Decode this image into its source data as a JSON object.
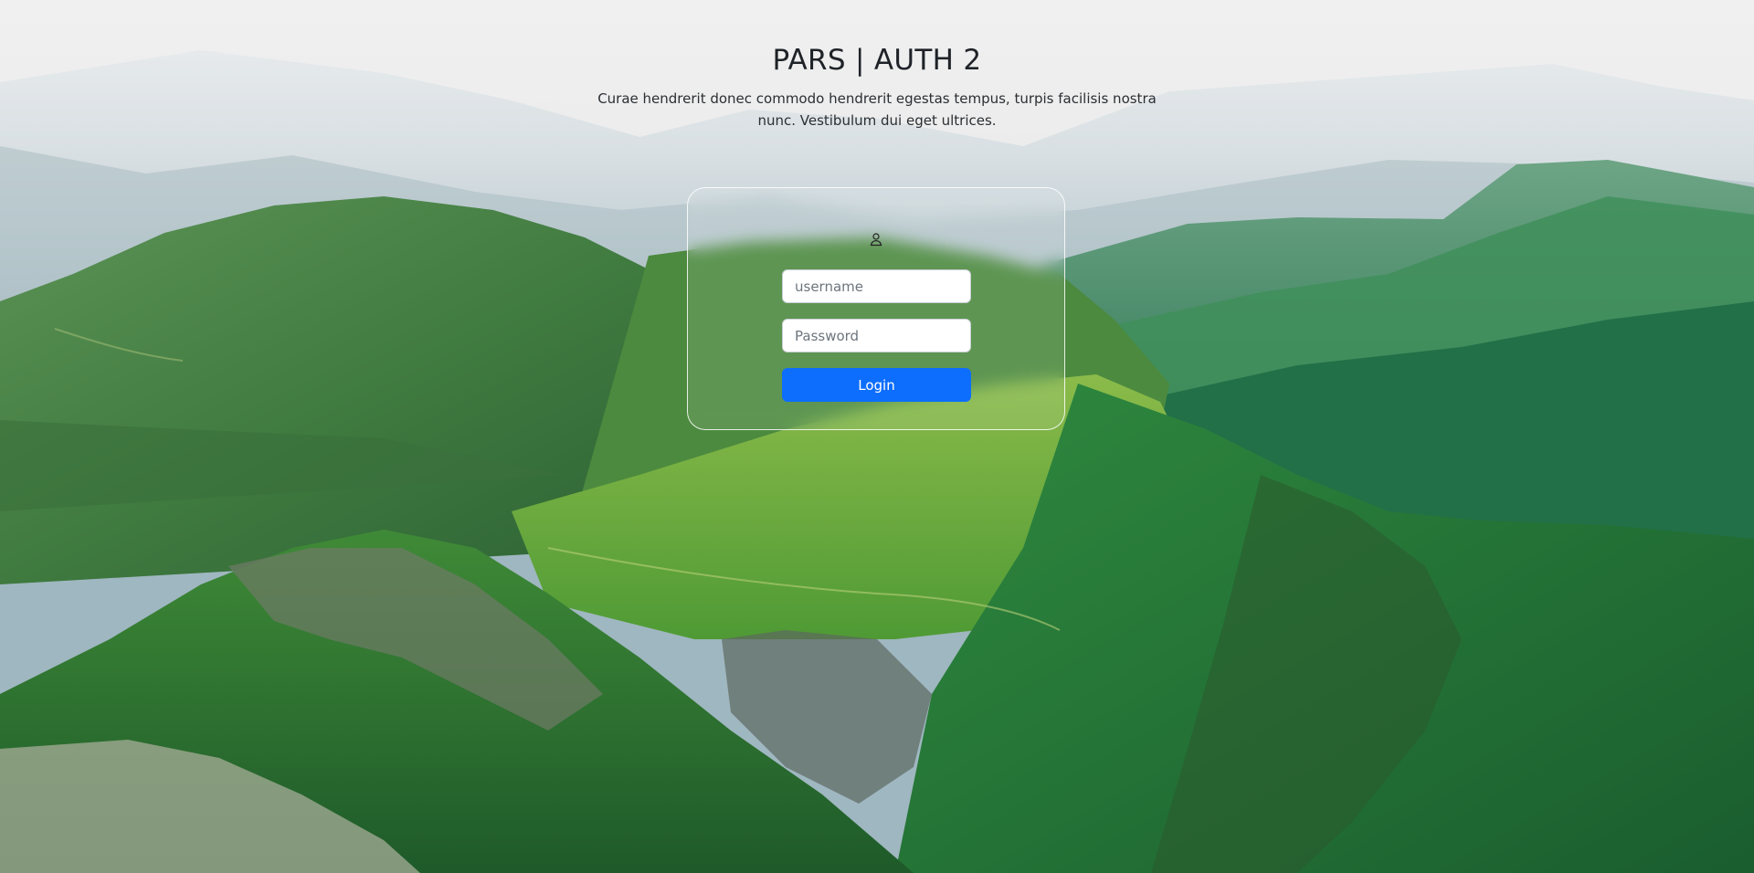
{
  "header": {
    "title": "PARS | AUTH 2",
    "subtitle": "Curae hendrerit donec commodo hendrerit egestas tempus, turpis facilisis nostra nunc. Vestibulum dui eget ultrices."
  },
  "login_form": {
    "icon": "user-icon",
    "username_placeholder": "username",
    "username_value": "",
    "password_placeholder": "Password",
    "password_value": "",
    "login_label": "Login"
  },
  "colors": {
    "accent": "#0d6efd",
    "text": "#1f2328",
    "sky": "#eeeeee",
    "mountain_green": "#2f7d3b"
  }
}
